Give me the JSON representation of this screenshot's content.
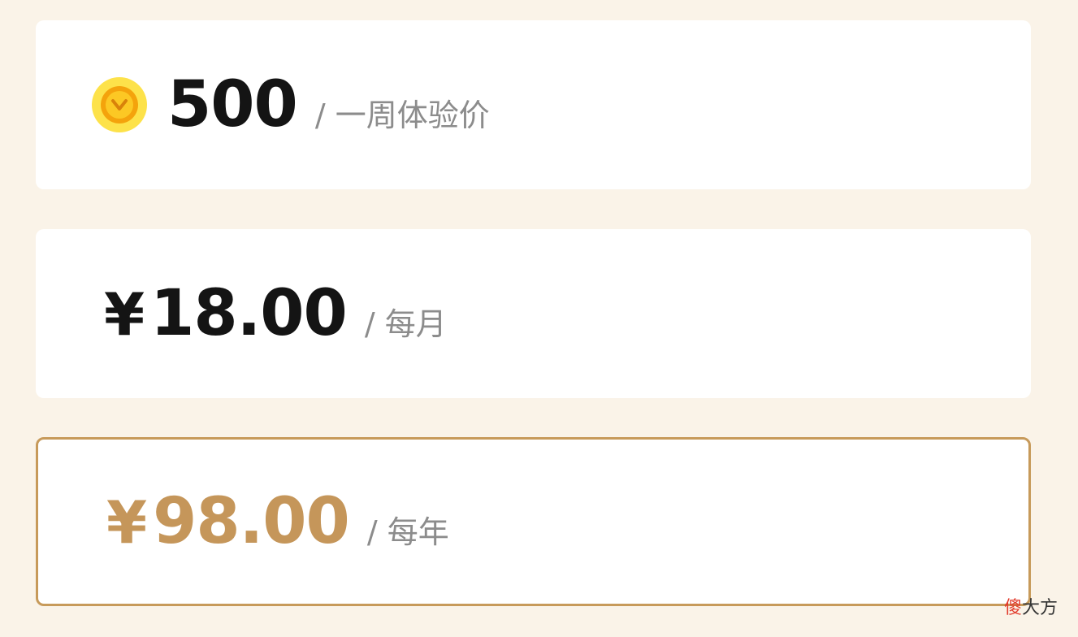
{
  "plans": {
    "week": {
      "icon": "gold-coin-icon",
      "amount": "500",
      "period": "/ 一周体验价"
    },
    "month": {
      "currency": "¥",
      "amount": "18.00",
      "period": "/ 每月"
    },
    "year": {
      "currency": "¥",
      "amount": "98.00",
      "period": "/ 每年",
      "selected": true
    }
  },
  "colors": {
    "background": "#faf3e8",
    "accent": "#c5965a",
    "coin": "#fde24a",
    "period_text": "#8c8c8c"
  },
  "watermark": {
    "first_char": "傻",
    "rest": "大方"
  }
}
